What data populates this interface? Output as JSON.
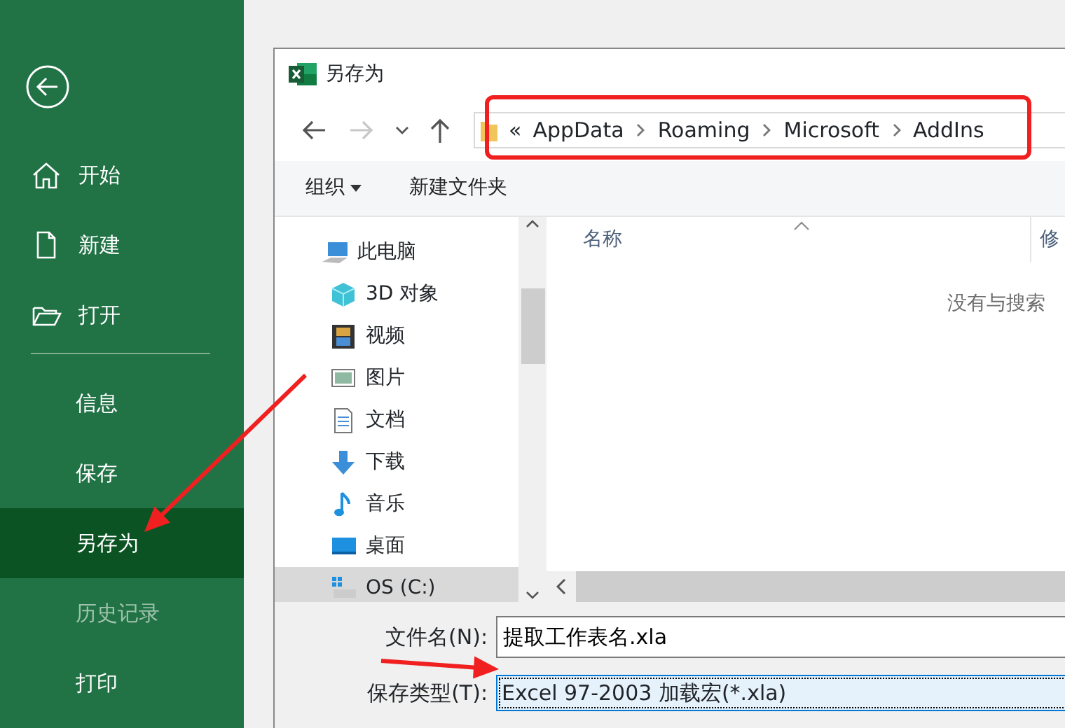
{
  "sidebar": {
    "sections": [
      [
        {
          "label": "开始",
          "kind": "home",
          "selected": false,
          "disabled": false
        },
        {
          "label": "新建",
          "kind": "new",
          "selected": false,
          "disabled": false
        },
        {
          "label": "打开",
          "kind": "open",
          "selected": false,
          "disabled": false
        }
      ],
      [
        {
          "label": "信息",
          "kind": "plain",
          "selected": false,
          "disabled": false
        },
        {
          "label": "保存",
          "kind": "plain",
          "selected": false,
          "disabled": false
        },
        {
          "label": "另存为",
          "kind": "plain",
          "selected": true,
          "disabled": false
        },
        {
          "label": "历史记录",
          "kind": "plain",
          "selected": false,
          "disabled": true
        },
        {
          "label": "打印",
          "kind": "plain",
          "selected": false,
          "disabled": false
        }
      ]
    ]
  },
  "dialog": {
    "title": "另存为",
    "nav_buttons": [
      {
        "kind": "back",
        "disabled": false
      },
      {
        "kind": "forward",
        "disabled": true
      },
      {
        "kind": "recent",
        "disabled": false
      },
      {
        "kind": "up",
        "disabled": false
      }
    ],
    "address": {
      "overflow": "«",
      "path": [
        "AppData",
        "Roaming",
        "Microsoft",
        "AddIns"
      ]
    },
    "toolbar": [
      {
        "label": "组织",
        "kind": "menu"
      },
      {
        "label": "新建文件夹",
        "kind": "plain"
      }
    ],
    "tree": [
      {
        "label": "此电脑",
        "kind": "pc",
        "selected": false,
        "children": [
          {
            "label": "3D 对象",
            "kind": "cube",
            "selected": false
          },
          {
            "label": "视频",
            "kind": "film",
            "selected": false
          },
          {
            "label": "图片",
            "kind": "picture",
            "selected": false
          },
          {
            "label": "文档",
            "kind": "doc",
            "selected": false
          },
          {
            "label": "下载",
            "kind": "download",
            "selected": false
          },
          {
            "label": "音乐",
            "kind": "music",
            "selected": false
          },
          {
            "label": "桌面",
            "kind": "desktop",
            "selected": false
          },
          {
            "label": "OS (C:)",
            "kind": "drive",
            "selected": true
          }
        ]
      }
    ],
    "columns": [
      "名称",
      "修"
    ],
    "empty_message": "没有与搜索",
    "file_name": {
      "label": "文件名(N):",
      "value": "提取工作表名.xla"
    },
    "file_type": {
      "label": "保存类型(T):",
      "value": "Excel 97-2003 加载宏(*.xla)",
      "focused": true
    }
  },
  "annotations": [
    {
      "kind": "box"
    },
    {
      "kind": "arrow"
    },
    {
      "kind": "arrow"
    }
  ]
}
